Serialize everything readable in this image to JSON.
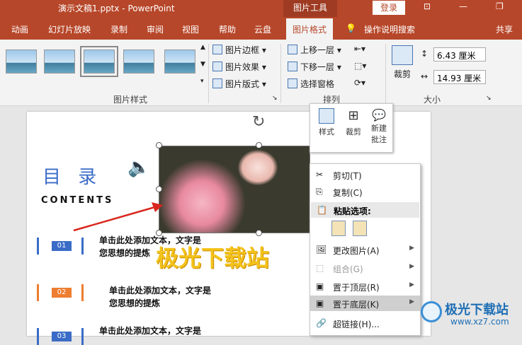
{
  "titlebar": {
    "doc_title": "演示文稿1.pptx  -  PowerPoint",
    "context_tab": "图片工具",
    "login": "登录"
  },
  "tabs": [
    {
      "label": "动画"
    },
    {
      "label": "幻灯片放映"
    },
    {
      "label": "录制"
    },
    {
      "label": "审阅"
    },
    {
      "label": "视图"
    },
    {
      "label": "帮助"
    },
    {
      "label": "云盘"
    },
    {
      "label": "图片格式"
    },
    {
      "label": "操作说明搜索"
    },
    {
      "label": "共享"
    }
  ],
  "ribbon": {
    "styles_group": "图片样式",
    "border": "图片边框",
    "effects": "图片效果",
    "layout": "图片版式",
    "bring_forward": "上移一层",
    "send_backward": "下移一层",
    "selection_pane": "选择窗格",
    "arrange_group": "排列",
    "crop": "裁剪",
    "height": "6.43 厘米",
    "width": "14.93 厘米",
    "size_group": "大小"
  },
  "slide": {
    "title": "目 录",
    "subtitle": "CONTENTS",
    "items": [
      {
        "num": "01",
        "text1": "单击此处添加文本，文字是",
        "text2": "您思想的提炼"
      },
      {
        "num": "02",
        "text1": "单击此处添加文本，文字是",
        "text2": "您思想的提炼"
      },
      {
        "num": "03",
        "text1": "单击此处添加文本，文字是",
        "text2": ""
      }
    ],
    "watermark": "极光下载站"
  },
  "minibar": {
    "style": "样式",
    "crop": "裁剪",
    "comment1": "新建",
    "comment2": "批注"
  },
  "menu": {
    "cut": "剪切(T)",
    "copy": "复制(C)",
    "paste_options": "粘贴选项:",
    "change_picture": "更改图片(A)",
    "group": "组合(G)",
    "bring_to_front": "置于顶层(R)",
    "send_to_back": "置于底层(K)",
    "hyperlink": "超链接(H)..."
  },
  "brand": {
    "name": "极光下载站",
    "url": "www.xz7.com"
  },
  "colors": {
    "accent": "#b7472a",
    "blue": "#3a6cc7",
    "orange": "#ed7d31"
  }
}
